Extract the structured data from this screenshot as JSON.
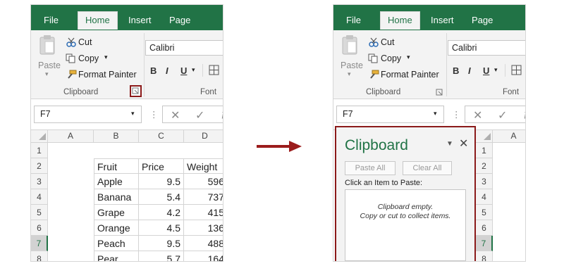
{
  "left": {
    "tabs": [
      "File",
      "Home",
      "Insert",
      "Page Layout"
    ],
    "clipboard": {
      "paste": "Paste",
      "cut": "Cut",
      "copy": "Copy",
      "format_painter": "Format Painter",
      "group_label": "Clipboard"
    },
    "font": {
      "font_name": "Calibri",
      "bold": "B",
      "italic": "I",
      "underline": "U",
      "group_label": "Font"
    },
    "name_box": "F7",
    "columns": [
      "A",
      "B",
      "C",
      "D"
    ],
    "rows": [
      "1",
      "2",
      "3",
      "4",
      "5",
      "6",
      "7",
      "8"
    ],
    "table": {
      "headers": [
        "Fruit",
        "Price",
        "Weight"
      ],
      "data": [
        [
          "Apple",
          "9.5",
          "596"
        ],
        [
          "Banana",
          "5.4",
          "737"
        ],
        [
          "Grape",
          "4.2",
          "415"
        ],
        [
          "Orange",
          "4.5",
          "136"
        ],
        [
          "Peach",
          "9.5",
          "488"
        ],
        [
          "Pear",
          "5.7",
          "164"
        ]
      ]
    }
  },
  "right": {
    "tabs": [
      "File",
      "Home",
      "Insert",
      "Page Layout"
    ],
    "clipboard": {
      "paste": "Paste",
      "cut": "Cut",
      "copy": "Copy",
      "format_painter": "Format Painter",
      "group_label": "Clipboard"
    },
    "font": {
      "font_name": "Calibri",
      "bold": "B",
      "italic": "I",
      "underline": "U",
      "group_label": "Font"
    },
    "name_box": "F7",
    "columns": [
      "A"
    ],
    "rows": [
      "1",
      "2",
      "3",
      "4",
      "5",
      "6",
      "7",
      "8"
    ],
    "pane": {
      "title": "Clipboard",
      "paste_all": "Paste All",
      "clear_all": "Clear All",
      "prompt": "Click an Item to Paste:",
      "empty_line1": "Clipboard empty.",
      "empty_line2": "Copy or cut to collect items."
    }
  },
  "colors": {
    "excel_green": "#217346",
    "highlight_red": "#8b1a1a"
  }
}
